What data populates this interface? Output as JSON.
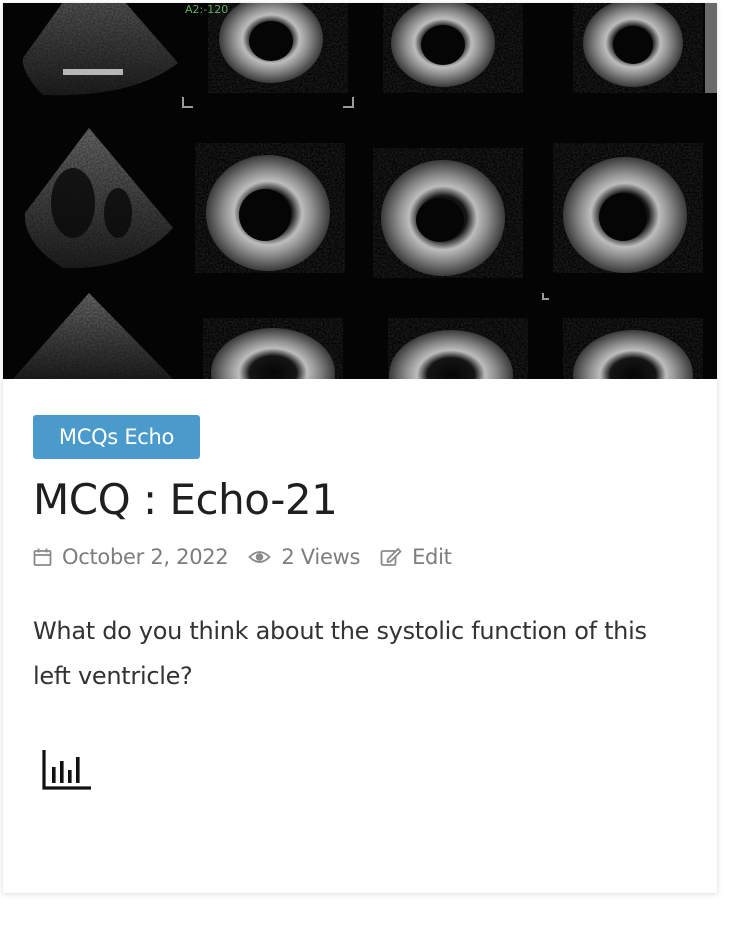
{
  "post": {
    "category": "MCQs Echo",
    "title": "MCQ : Echo-21",
    "date": "October 2, 2022",
    "views": "2 Views",
    "edit_label": "Edit",
    "excerpt": "What do you think about the systolic function of this left ventricle?"
  },
  "image": {
    "overlay_text": "A2:-120"
  },
  "icons": {
    "date": "calendar-icon",
    "views": "eye-icon",
    "edit": "edit-icon",
    "poll": "bar-chart-icon"
  },
  "colors": {
    "badge_bg": "#4a9bcb",
    "title": "#1f1f1f",
    "meta": "#7d7d7d",
    "excerpt": "#333333"
  }
}
